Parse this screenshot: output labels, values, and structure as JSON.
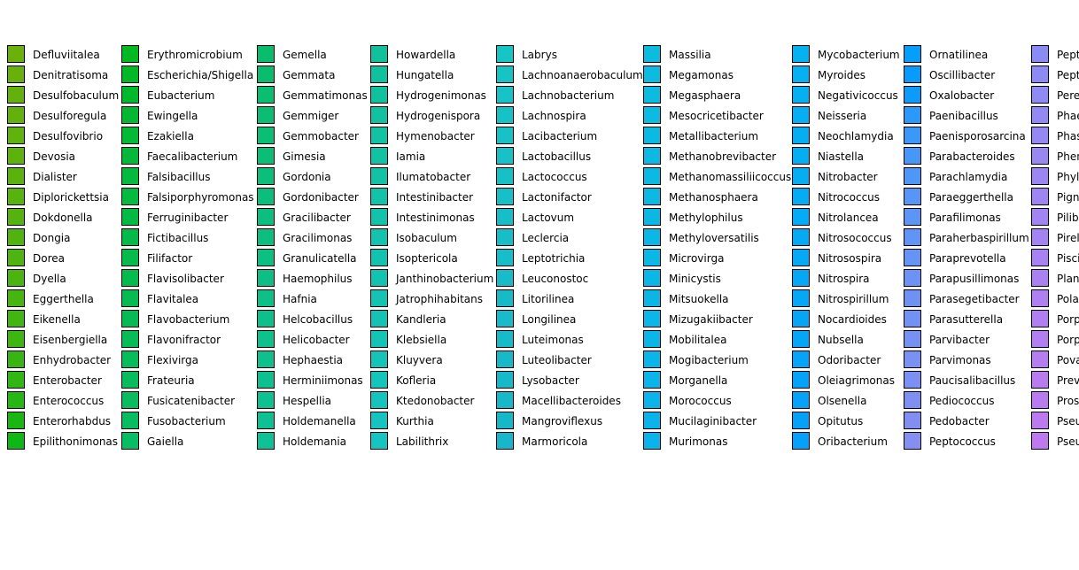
{
  "chart_data": {
    "type": "legend",
    "columns": [
      {
        "entries": [
          {
            "label": "Defluviitalea",
            "color": "#6ab10a"
          },
          {
            "label": "Denitratisoma",
            "color": "#68b10a"
          },
          {
            "label": "Desulfobaculum",
            "color": "#65b10b"
          },
          {
            "label": "Desulforegula",
            "color": "#62b20b"
          },
          {
            "label": "Desulfovibrio",
            "color": "#60b20c"
          },
          {
            "label": "Devosia",
            "color": "#5db20c"
          },
          {
            "label": "Dialister",
            "color": "#5ab30d"
          },
          {
            "label": "Diplorickettsia",
            "color": "#57b30d"
          },
          {
            "label": "Dokdonella",
            "color": "#54b30e"
          },
          {
            "label": "Dongia",
            "color": "#51b40e"
          },
          {
            "label": "Dorea",
            "color": "#4eb40f"
          },
          {
            "label": "Dyella",
            "color": "#4ab50f"
          },
          {
            "label": "Eggerthella",
            "color": "#46b510"
          },
          {
            "label": "Eikenella",
            "color": "#42b510"
          },
          {
            "label": "Eisenbergiella",
            "color": "#3db611"
          },
          {
            "label": "Enhydrobacter",
            "color": "#37b611"
          },
          {
            "label": "Enterobacter",
            "color": "#30b712"
          },
          {
            "label": "Enterococcus",
            "color": "#27b712"
          },
          {
            "label": "Enterorhabdus",
            "color": "#1ab713"
          },
          {
            "label": "Epilithonimonas",
            "color": "#0db814"
          }
        ]
      },
      {
        "entries": [
          {
            "label": "Erythromicrobium",
            "color": "#03b820"
          },
          {
            "label": "Escherichia/Shigella",
            "color": "#03b826"
          },
          {
            "label": "Eubacterium",
            "color": "#03b82c"
          },
          {
            "label": "Ewingella",
            "color": "#04b931"
          },
          {
            "label": "Ezakiella",
            "color": "#04b935"
          },
          {
            "label": "Faecalibacterium",
            "color": "#04b939"
          },
          {
            "label": "Falsibacillus",
            "color": "#04b93d"
          },
          {
            "label": "Falsiporphyromonas",
            "color": "#05ba41"
          },
          {
            "label": "Ferruginibacter",
            "color": "#05ba44"
          },
          {
            "label": "Fictibacillus",
            "color": "#05ba48"
          },
          {
            "label": "Filifactor",
            "color": "#06ba4b"
          },
          {
            "label": "Flavisolibacter",
            "color": "#06bb4e"
          },
          {
            "label": "Flavitalea",
            "color": "#06bb51"
          },
          {
            "label": "Flavobacterium",
            "color": "#07bb54"
          },
          {
            "label": "Flavonifractor",
            "color": "#07bb57"
          },
          {
            "label": "Flexivirga",
            "color": "#07bc5a"
          },
          {
            "label": "Frateuria",
            "color": "#08bc5d"
          },
          {
            "label": "Fusicatenibacter",
            "color": "#08bc5f"
          },
          {
            "label": "Fusobacterium",
            "color": "#08bc62"
          },
          {
            "label": "Gaiella",
            "color": "#09bd65"
          }
        ]
      },
      {
        "entries": [
          {
            "label": "Gemella",
            "color": "#09bd6c"
          },
          {
            "label": "Gemmata",
            "color": "#09bd6e"
          },
          {
            "label": "Gemmatimonas",
            "color": "#0abd71"
          },
          {
            "label": "Gemmiger",
            "color": "#0abd73"
          },
          {
            "label": "Gemmobacter",
            "color": "#0abe76"
          },
          {
            "label": "Gimesia",
            "color": "#0bbe78"
          },
          {
            "label": "Gordonia",
            "color": "#0bbe7a"
          },
          {
            "label": "Gordonibacter",
            "color": "#0bbe7d"
          },
          {
            "label": "Gracilibacter",
            "color": "#0cbe7f"
          },
          {
            "label": "Gracilimonas",
            "color": "#0cbf81"
          },
          {
            "label": "Granulicatella",
            "color": "#0cbf83"
          },
          {
            "label": "Haemophilus",
            "color": "#0dbf86"
          },
          {
            "label": "Hafnia",
            "color": "#0dbf88"
          },
          {
            "label": "Helcobacillus",
            "color": "#0dbf8a"
          },
          {
            "label": "Helicobacter",
            "color": "#0ec08c"
          },
          {
            "label": "Hephaestia",
            "color": "#0ec08e"
          },
          {
            "label": "Herminiimonas",
            "color": "#0ec090"
          },
          {
            "label": "Hespellia",
            "color": "#0fc092"
          },
          {
            "label": "Holdemanella",
            "color": "#0fc095"
          },
          {
            "label": "Holdemania",
            "color": "#0fc197"
          }
        ]
      },
      {
        "entries": [
          {
            "label": "Howardella",
            "color": "#10c19b"
          },
          {
            "label": "Hungatella",
            "color": "#10c19d"
          },
          {
            "label": "Hydrogenimonas",
            "color": "#10c19f"
          },
          {
            "label": "Hydrogenispora",
            "color": "#11c1a1"
          },
          {
            "label": "Hymenobacter",
            "color": "#11c2a3"
          },
          {
            "label": "Iamia",
            "color": "#11c2a5"
          },
          {
            "label": "Ilumatobacter",
            "color": "#12c2a7"
          },
          {
            "label": "Intestinibacter",
            "color": "#12c2a9"
          },
          {
            "label": "Intestinimonas",
            "color": "#12c2ab"
          },
          {
            "label": "Isobaculum",
            "color": "#13c3ad"
          },
          {
            "label": "Isoptericola",
            "color": "#13c3af"
          },
          {
            "label": "Janthinobacterium",
            "color": "#13c3b1"
          },
          {
            "label": "Jatrophihabitans",
            "color": "#14c3b3"
          },
          {
            "label": "Kandleria",
            "color": "#14c3b5"
          },
          {
            "label": "Klebsiella",
            "color": "#14c4b7"
          },
          {
            "label": "Kluyvera",
            "color": "#15c4b9"
          },
          {
            "label": "Kofleria",
            "color": "#15c4bb"
          },
          {
            "label": "Ktedonobacter",
            "color": "#15c4bd"
          },
          {
            "label": "Kurthia",
            "color": "#16c4bf"
          },
          {
            "label": "Labilithrix",
            "color": "#16c5c1"
          }
        ]
      },
      {
        "entries": [
          {
            "label": "Labrys",
            "color": "#16c5c5"
          },
          {
            "label": "Lachnoanaerobaculum",
            "color": "#16c4c6"
          },
          {
            "label": "Lachnobacterium",
            "color": "#17c3c6"
          },
          {
            "label": "Lachnospira",
            "color": "#17c2c6"
          },
          {
            "label": "Lacibacterium",
            "color": "#17c1c6"
          },
          {
            "label": "Lactobacillus",
            "color": "#17c1c7"
          },
          {
            "label": "Lactococcus",
            "color": "#17c0c7"
          },
          {
            "label": "Lactonifactor",
            "color": "#17bfc7"
          },
          {
            "label": "Lactovum",
            "color": "#17bec7"
          },
          {
            "label": "Leclercia",
            "color": "#17bec8"
          },
          {
            "label": "Leptotrichia",
            "color": "#17bdc8"
          },
          {
            "label": "Leuconostoc",
            "color": "#17bcc8"
          },
          {
            "label": "Litorilinea",
            "color": "#17bbc8"
          },
          {
            "label": "Longilinea",
            "color": "#17bbc9"
          },
          {
            "label": "Luteimonas",
            "color": "#17bac9"
          },
          {
            "label": "Luteolibacter",
            "color": "#17b9c9"
          },
          {
            "label": "Lysobacter",
            "color": "#17b8c9"
          },
          {
            "label": "Macellibacteroides",
            "color": "#17b8ca"
          },
          {
            "label": "Mangroviflexus",
            "color": "#17b7ca"
          },
          {
            "label": "Marmoricola",
            "color": "#17b6ca"
          }
        ]
      },
      {
        "entries": [
          {
            "label": "Massilia",
            "color": "#0bbcdf"
          },
          {
            "label": "Megamonas",
            "color": "#0bbce0"
          },
          {
            "label": "Megasphaera",
            "color": "#0bbbe0"
          },
          {
            "label": "Mesocricetibacter",
            "color": "#0bbbe1"
          },
          {
            "label": "Metallibacterium",
            "color": "#0bbae2"
          },
          {
            "label": "Methanobrevibacter",
            "color": "#0bbae2"
          },
          {
            "label": "Methanomassiliicoccus",
            "color": "#0bb9e3"
          },
          {
            "label": "Methanosphaera",
            "color": "#0bb9e4"
          },
          {
            "label": "Methylophilus",
            "color": "#0bb8e4"
          },
          {
            "label": "Methyloversatilis",
            "color": "#0bb8e5"
          },
          {
            "label": "Microvirga",
            "color": "#0bb7e6"
          },
          {
            "label": "Minicystis",
            "color": "#0bb7e6"
          },
          {
            "label": "Mitsuokella",
            "color": "#0bb6e7"
          },
          {
            "label": "Mizugakiibacter",
            "color": "#0bb6e8"
          },
          {
            "label": "Mobilitalea",
            "color": "#0bb5e8"
          },
          {
            "label": "Mogibacterium",
            "color": "#0bb5e9"
          },
          {
            "label": "Morganella",
            "color": "#0bb4ea"
          },
          {
            "label": "Morococcus",
            "color": "#0bb4ea"
          },
          {
            "label": "Mucilaginibacter",
            "color": "#0bb3eb"
          },
          {
            "label": "Murimonas",
            "color": "#0bb3ec"
          }
        ]
      },
      {
        "entries": [
          {
            "label": "Mycobacterium",
            "color": "#05b2f0"
          },
          {
            "label": "Myroides",
            "color": "#05b1f0"
          },
          {
            "label": "Negativicoccus",
            "color": "#05b0f1"
          },
          {
            "label": "Neisseria",
            "color": "#05aff1"
          },
          {
            "label": "Neochlamydia",
            "color": "#05aef2"
          },
          {
            "label": "Niastella",
            "color": "#05aef2"
          },
          {
            "label": "Nitrobacter",
            "color": "#05adf3"
          },
          {
            "label": "Nitrococcus",
            "color": "#05acf3"
          },
          {
            "label": "Nitrolancea",
            "color": "#05abf4"
          },
          {
            "label": "Nitrosococcus",
            "color": "#05aaf4"
          },
          {
            "label": "Nitrosospira",
            "color": "#05a9f5"
          },
          {
            "label": "Nitrospira",
            "color": "#05a8f5"
          },
          {
            "label": "Nitrospirillum",
            "color": "#05a7f6"
          },
          {
            "label": "Nocardioides",
            "color": "#05a6f6"
          },
          {
            "label": "Nubsella",
            "color": "#05a5f7"
          },
          {
            "label": "Odoribacter",
            "color": "#05a4f7"
          },
          {
            "label": "Oleiagrimonas",
            "color": "#05a3f8"
          },
          {
            "label": "Olsenella",
            "color": "#05a2f8"
          },
          {
            "label": "Opitutus",
            "color": "#05a1f9"
          },
          {
            "label": "Oribacterium",
            "color": "#05a0f9"
          }
        ]
      },
      {
        "entries": [
          {
            "label": "Ornatilinea",
            "color": "#049efb"
          },
          {
            "label": "Oscillibacter",
            "color": "#079cfb"
          },
          {
            "label": "Oxalobacter",
            "color": "#0c9afb"
          },
          {
            "label": "Paenibacillus",
            "color": "#2a99fa"
          },
          {
            "label": "Paenisporosarcina",
            "color": "#3a98f9"
          },
          {
            "label": "Parabacteroides",
            "color": "#4597f8"
          },
          {
            "label": "Parachlamydia",
            "color": "#4e96f8"
          },
          {
            "label": "Paraeggerthella",
            "color": "#5596f7"
          },
          {
            "label": "Parafilimonas",
            "color": "#5b95f6"
          },
          {
            "label": "Paraherbaspirillum",
            "color": "#6094f6"
          },
          {
            "label": "Paraprevotella",
            "color": "#6594f5"
          },
          {
            "label": "Parapusillimonas",
            "color": "#6a93f5"
          },
          {
            "label": "Parasegetibacter",
            "color": "#6e92f4"
          },
          {
            "label": "Parasutterella",
            "color": "#7192f4"
          },
          {
            "label": "Parvibacter",
            "color": "#7591f3"
          },
          {
            "label": "Parvimonas",
            "color": "#7891f3"
          },
          {
            "label": "Paucisalibacillus",
            "color": "#7b90f2"
          },
          {
            "label": "Pediococcus",
            "color": "#7e90f2"
          },
          {
            "label": "Pedobacter",
            "color": "#818ff1"
          },
          {
            "label": "Peptococcus",
            "color": "#848ff1"
          }
        ]
      },
      {
        "entries": [
          {
            "label": "Pept",
            "color": "#8a8cf3"
          },
          {
            "label": "Pept",
            "color": "#8d8bf3"
          },
          {
            "label": "Pere",
            "color": "#908af3"
          },
          {
            "label": "Phae",
            "color": "#9389f3"
          },
          {
            "label": "Phas",
            "color": "#9688f3"
          },
          {
            "label": "Phen",
            "color": "#9987f2"
          },
          {
            "label": "Phyl",
            "color": "#9c86f2"
          },
          {
            "label": "Pign",
            "color": "#9f85f2"
          },
          {
            "label": "Pilib",
            "color": "#a284f2"
          },
          {
            "label": "Pirel",
            "color": "#a583f2"
          },
          {
            "label": "Pisci",
            "color": "#a882f2"
          },
          {
            "label": "Plan",
            "color": "#ab81f1"
          },
          {
            "label": "Pola",
            "color": "#ae80f1"
          },
          {
            "label": "Porp",
            "color": "#b17ff1"
          },
          {
            "label": "Porp",
            "color": "#b37ef1"
          },
          {
            "label": "Pova",
            "color": "#b67df1"
          },
          {
            "label": "Prev",
            "color": "#b87cf0"
          },
          {
            "label": "Pros",
            "color": "#ba7bf0"
          },
          {
            "label": "Pseu",
            "color": "#bc7af0"
          },
          {
            "label": "Pseu",
            "color": "#be79f0"
          }
        ]
      }
    ]
  }
}
